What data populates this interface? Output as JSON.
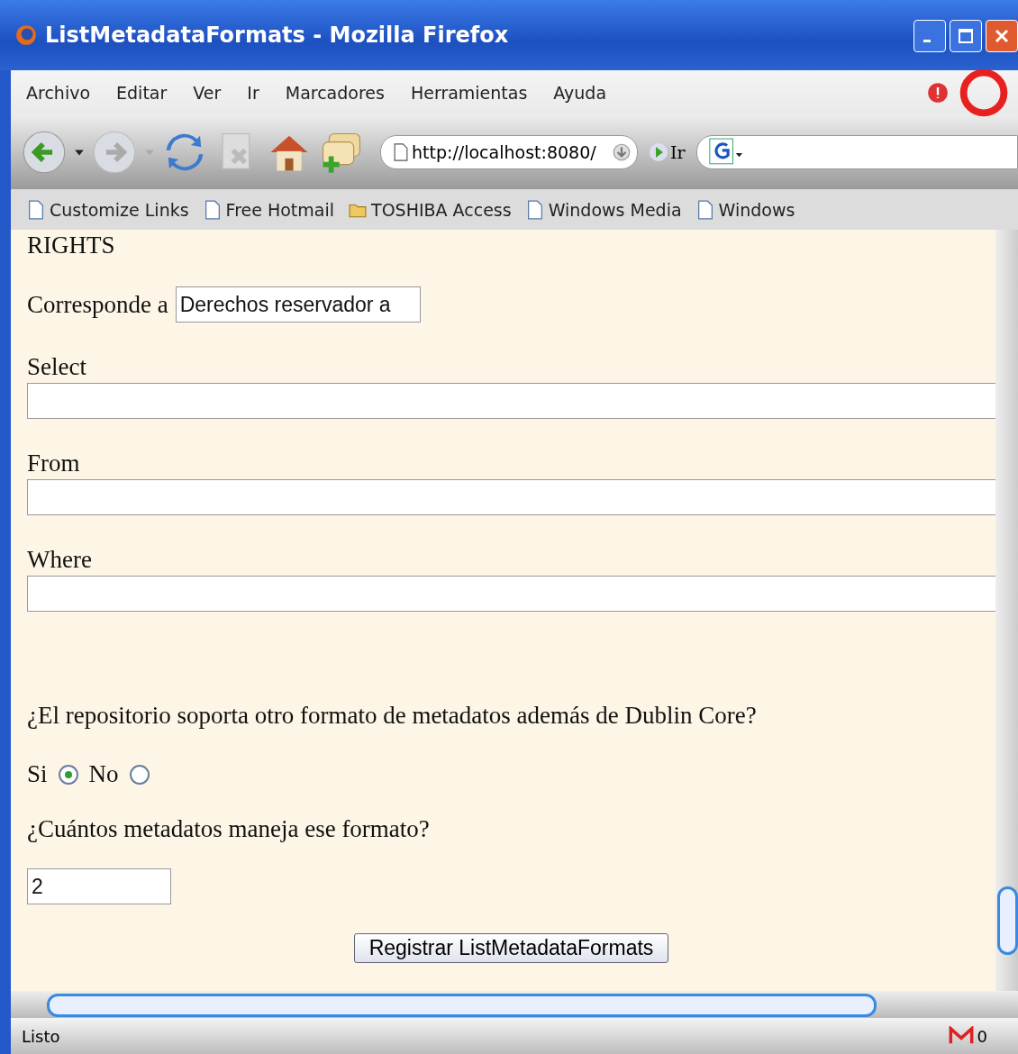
{
  "window": {
    "title": "ListMetadataFormats - Mozilla Firefox"
  },
  "menu": [
    "Archivo",
    "Editar",
    "Ver",
    "Ir",
    "Marcadores",
    "Herramientas",
    "Ayuda"
  ],
  "toolbar": {
    "address": "http://localhost:8080/",
    "go": "Ir"
  },
  "bookmarks": [
    {
      "label": "Customize Links",
      "kind": "page"
    },
    {
      "label": "Free Hotmail",
      "kind": "page"
    },
    {
      "label": "TOSHIBA Access",
      "kind": "folder"
    },
    {
      "label": "Windows Media",
      "kind": "page"
    },
    {
      "label": "Windows",
      "kind": "page"
    }
  ],
  "form": {
    "heading": "RIGHTS",
    "corresponds_label": "Corresponde a",
    "corresponds_value": "Derechos reservador a",
    "fields": [
      {
        "label": "Select"
      },
      {
        "label": "From"
      },
      {
        "label": "Where"
      }
    ],
    "question": "¿El repositorio soporta otro formato de metadatos además de Dublin Core?",
    "options": [
      {
        "label": "Si",
        "selected": true
      },
      {
        "label": "No",
        "selected": false
      }
    ],
    "count_question": "¿Cuántos metadatos maneja ese formato?",
    "count_value": "2",
    "submit": "Registrar ListMetadataFormats"
  },
  "status_bar": {
    "text": "Listo",
    "mail_count": "0"
  }
}
